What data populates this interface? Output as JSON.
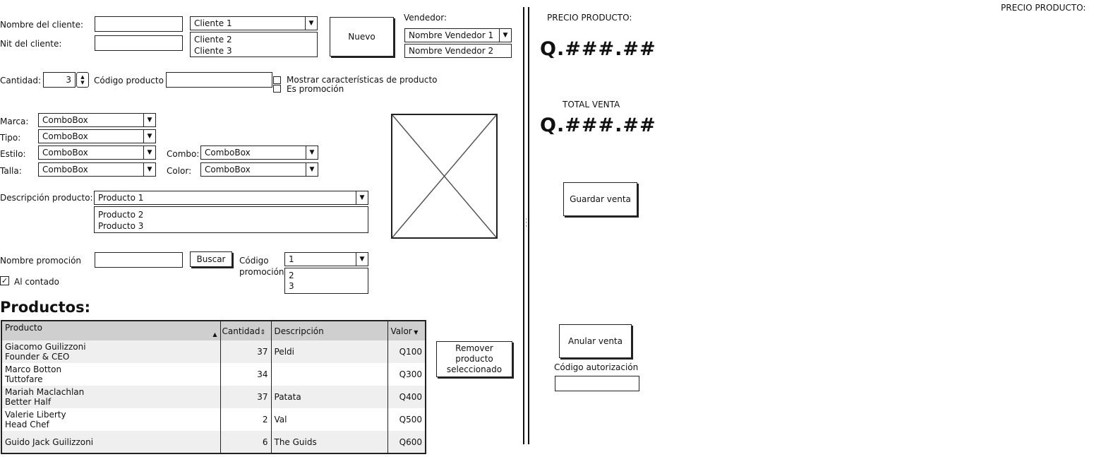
{
  "top_right_label": "PRECIO PRODUCTO:",
  "client": {
    "name_label": "Nombre del cliente:",
    "nit_label": "Nit del cliente:",
    "name_value": "",
    "nit_value": "",
    "combo_selected": "Cliente 1",
    "combo_options": [
      "Cliente 2",
      "Cliente 3"
    ],
    "new_button": "Nuevo"
  },
  "seller": {
    "label": "Vendedor:",
    "selected": "Nombre Vendedor 1",
    "options": [
      "Nombre Vendedor 2"
    ]
  },
  "product_entry": {
    "quantity_label": "Cantidad:",
    "quantity_value": "3",
    "code_label": "Código producto",
    "code_value": "",
    "show_features_label": "Mostrar características de producto",
    "is_promo_label": "Es promoción"
  },
  "filters": {
    "brand_label": "Marca:",
    "type_label": "Tipo:",
    "style_label": "Estilo:",
    "size_label": "Talla:",
    "combo_label": "Combo:",
    "color_label": "Color:",
    "brand_value": "ComboBox",
    "type_value": "ComboBox",
    "style_value": "ComboBox",
    "size_value": "ComboBox",
    "combo_value": "ComboBox",
    "color_value": "ComboBox"
  },
  "description": {
    "label": "Descripción producto:",
    "selected": "Producto 1",
    "options": [
      "Producto 2",
      "Producto 3"
    ]
  },
  "promotion": {
    "name_label": "Nombre promoción",
    "name_value": "",
    "search_button": "Buscar",
    "code_label_1": "Código",
    "code_label_2": "promoción",
    "code_selected": "1",
    "code_options": [
      "2",
      "3"
    ],
    "cash_label": "Al contado",
    "cash_checked": true
  },
  "products": {
    "title": "Productos:",
    "columns": [
      "Producto",
      "Cantidad",
      "Descripción",
      "Valor"
    ],
    "rows": [
      {
        "name": "Giacomo Guilizzoni",
        "sub": "Founder & CEO",
        "qty": "37",
        "desc": "Peldi",
        "value": "Q100"
      },
      {
        "name": "Marco Botton",
        "sub": "Tuttofare",
        "qty": "34",
        "desc": "",
        "value": "Q300"
      },
      {
        "name": "Mariah Maclachlan",
        "sub": "Better Half",
        "qty": "37",
        "desc": "Patata",
        "value": "Q400"
      },
      {
        "name": "Valerie Liberty",
        "sub": "Head Chef",
        "qty": "2",
        "desc": "Val",
        "value": "Q500"
      },
      {
        "name": "Guido Jack Guilizzoni",
        "sub": "",
        "qty": "6",
        "desc": "The Guids",
        "value": "Q600"
      }
    ],
    "remove_line1": "Remover",
    "remove_line2": "producto",
    "remove_line3": "seleccionado"
  },
  "summary": {
    "price_label": "PRECIO PRODUCTO:",
    "price_value": "Q.###.##",
    "total_label": "TOTAL VENTA",
    "total_value": "Q.###.##",
    "save_button": "Guardar venta",
    "cancel_button": "Anular venta",
    "auth_label": "Código autorización",
    "auth_value": ""
  }
}
